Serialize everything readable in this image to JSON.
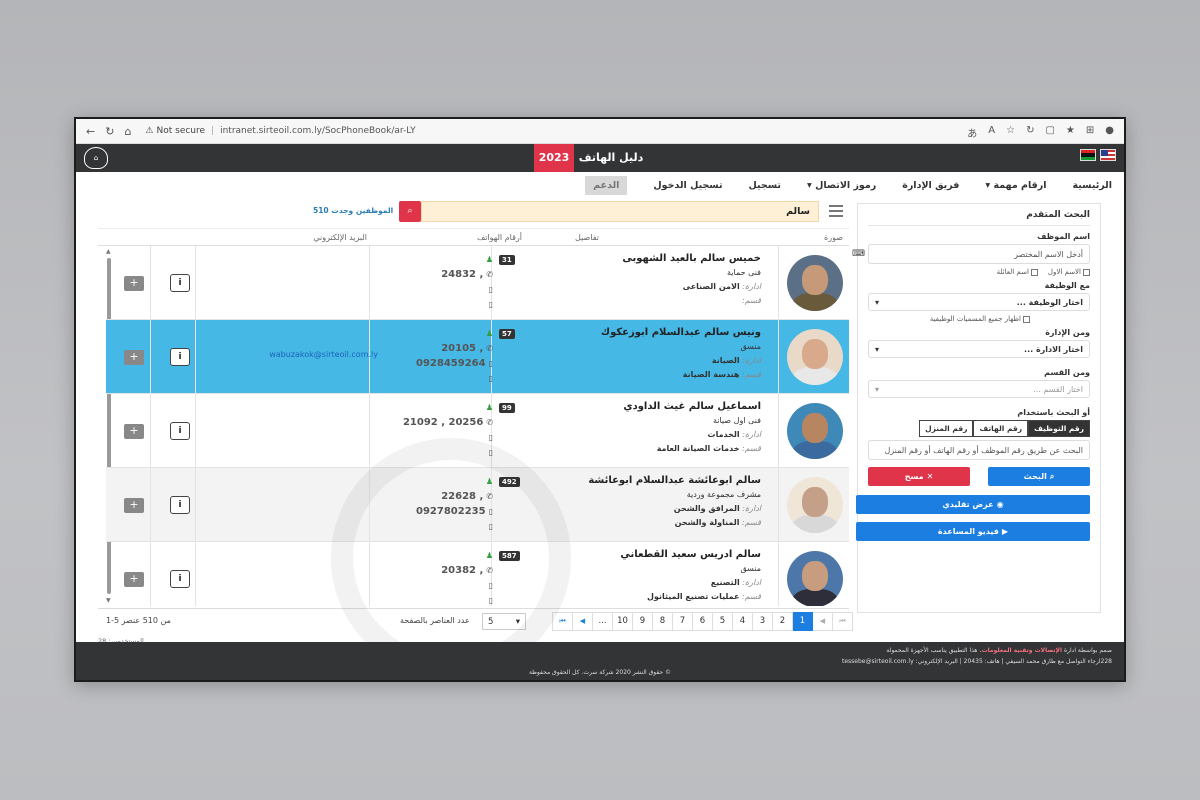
{
  "browser": {
    "url_security": "Not secure",
    "url": "intranet.sirteoil.com.ly/SocPhoneBook/ar-LY"
  },
  "header": {
    "title": "دليل الهاتف",
    "year": "2023"
  },
  "menu": {
    "items": [
      "الرئيسية",
      "ارقام مهمة",
      "فريق الإدارة",
      "رموز الاتصال",
      "تسجيل",
      "تسجيل الدخول",
      "الدعم"
    ]
  },
  "sidebar": {
    "heading": "البحث المتقدم",
    "employee_name_label": "اسم الموظف",
    "employee_name_placeholder": "أدخل الاسم المختصر",
    "chk_first_name": "الاسم الاول",
    "chk_family_name": "اسم العائلة",
    "job_label": "مع الوظيفة",
    "job_select": "اختار الوظيفة ...",
    "show_all_titles": "اظهار جميع المسميات الوظيفية",
    "dept_label": "ومن الإدارة",
    "dept_select": "اختار الادارة ...",
    "section_label": "ومن القسم",
    "section_select": "اختار القسم ...",
    "search_by_label": "أو البحث باستخدام",
    "tabs": [
      "رقم التوظيف",
      "رقم الهاتف",
      "رقم المنزل"
    ],
    "search_by_placeholder": "البحث عن طريق رقم الموظف أو رقم الهاتف أو رقم المنزل",
    "search_button": "البحث",
    "clear_button": "مسح",
    "classic_view_button": "عرض تقليدي",
    "help_video_button": "فيديو المساعدة"
  },
  "search": {
    "value": "سالم",
    "found_text": "510 الموظفين وجدت"
  },
  "table": {
    "headers": {
      "photo": "صورة",
      "details": "تفاصيل",
      "phones": "أرقام الهواتف",
      "email": "البريد الإلكتروني"
    },
    "dept_prefix": "ادارة:",
    "section_prefix": "قسم:",
    "rows": [
      {
        "name": "خميس سالم بالعيد الشهوبى",
        "job": "فنى حماية",
        "dept": "الامن الصناعى",
        "section": "",
        "id": "31",
        "phone1": "24832 ,",
        "phone2": "",
        "email": "",
        "selected": false,
        "alt": false
      },
      {
        "name": "ونيس سالم عبدالسلام ابوزعكوك",
        "job": "منسق",
        "dept": "الصيانة",
        "section": "هندسة الصيانة",
        "id": "57",
        "phone1": "20105 ,",
        "phone2": "0928459264",
        "email": "wabuzakok@sirteoil.com.ly",
        "selected": true,
        "alt": false
      },
      {
        "name": "اسماعيل سالم غيث الداودي",
        "job": "فنى اول صيانة",
        "dept": "الخدمات",
        "section": "خدمات الصيانة العامة",
        "id": "99",
        "phone1": "21092 , 20256",
        "phone2": "",
        "email": "",
        "selected": false,
        "alt": false
      },
      {
        "name": "سالم ابوعائشة عبدالسلام ابوعائشة",
        "job": "مشرف مجموعة وردية",
        "dept": "المرافق والشحن",
        "section": "المناولة والشحن",
        "id": "492",
        "phone1": "22628 ,",
        "phone2": "0927802235",
        "email": "",
        "selected": false,
        "alt": true
      },
      {
        "name": "سالم ادريس سعيد القطعاني",
        "job": "منسق",
        "dept": "التصنيع",
        "section": "عمليات تصنيع الميثانول",
        "id": "587",
        "phone1": "20382 ,",
        "phone2": "",
        "email": "",
        "selected": false,
        "alt": false
      }
    ]
  },
  "pager": {
    "pages": [
      "1",
      "2",
      "3",
      "4",
      "5",
      "6",
      "7",
      "8",
      "9",
      "10",
      "..."
    ],
    "current": "1",
    "page_size": "5",
    "page_size_label": "عدد العناصر بالصفحة",
    "total_text": "1-5 من 510 عنصر"
  },
  "users_text": "المستخدمين: 28",
  "footer": {
    "line1_prefix": "صمم بواسطة ادارة",
    "line1_red": "الإتصالات وتقنية المعلومات.",
    "line1_suffix": "هذا التطبيق يناسب الأجهزة المحمولة",
    "line2": "228ارجاء التواصل مع طارق محمد السيفي | هاتف: 20435 | البريد الإلكتروني: tessebe@sirteoil.com.ly",
    "line3": "© حقوق النشر 2020 شركة سرت. كل الحقوق محفوظة"
  },
  "colors": {
    "accent_blue": "#1b7ee0",
    "accent_red": "#e0344a",
    "selected_row": "#45b8e6",
    "header_dark": "#323436"
  }
}
